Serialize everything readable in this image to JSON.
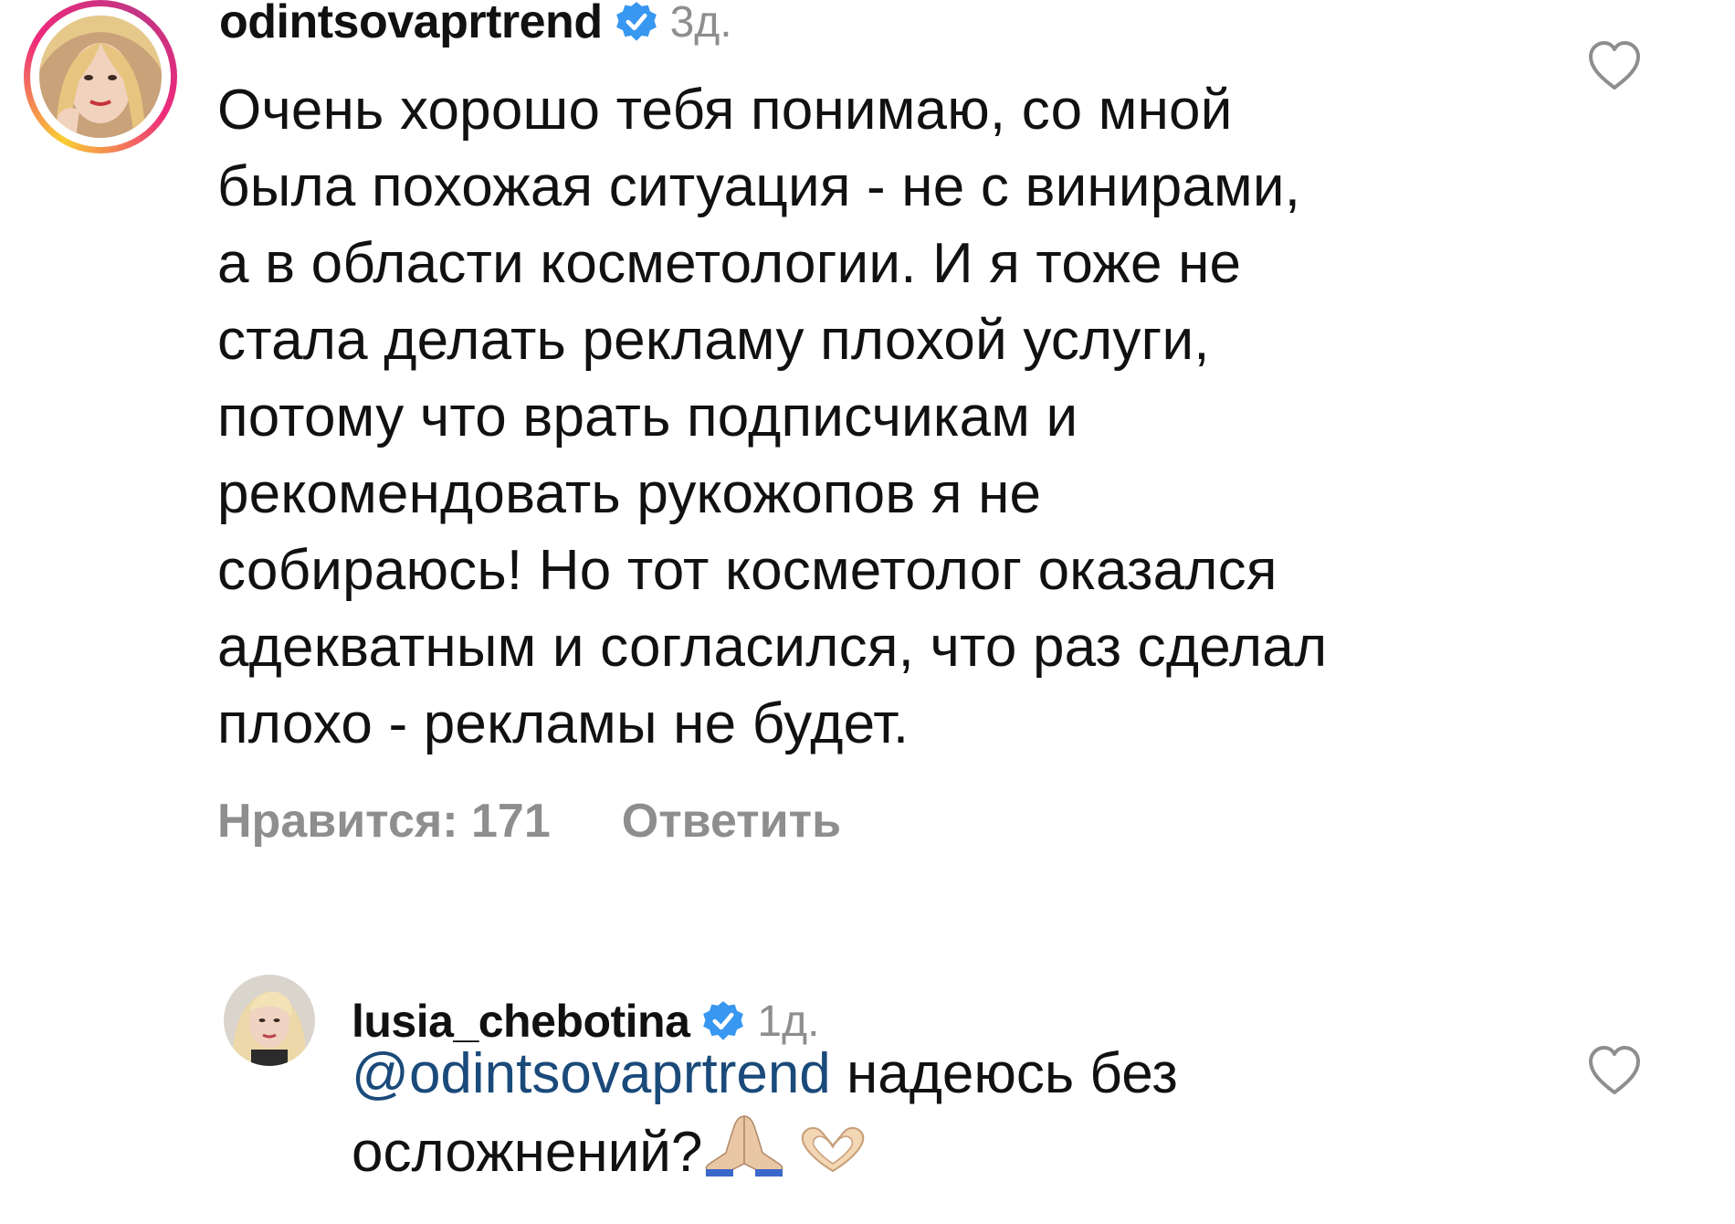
{
  "comment_main": {
    "username": "odintsovaprtrend",
    "time": "3д.",
    "lines": [
      "Очень хорошо тебя понимаю, со мной",
      "была похожая ситуация - не с винирами,",
      "а в области косметологии. И я тоже не",
      "стала делать рекламу плохой услуги,",
      "потому что врать подписчикам и",
      "рекомендовать рукожопов я не",
      "собираюсь! Но тот косметолог оказался",
      "адекватным и согласился, что раз сделал",
      "плохо - рекламы не будет."
    ],
    "likes_label": "Нравится: 171",
    "reply_label": "Ответить"
  },
  "comment_reply": {
    "username": "lusia_chebotina",
    "time": "1д.",
    "mention": "@odintsovaprtrend",
    "text_after_mention": " надеюсь без",
    "line2": "осложнений?"
  },
  "icons": {
    "verified": "verified-badge-icon",
    "like": "heart-outline-icon",
    "emoji_1": "folded-hands-emoji",
    "emoji_2": "heart-hands-emoji"
  },
  "colors": {
    "verified": "#3897f0",
    "meta_gray": "#8e8e8e",
    "mention": "#1a4a7a"
  }
}
